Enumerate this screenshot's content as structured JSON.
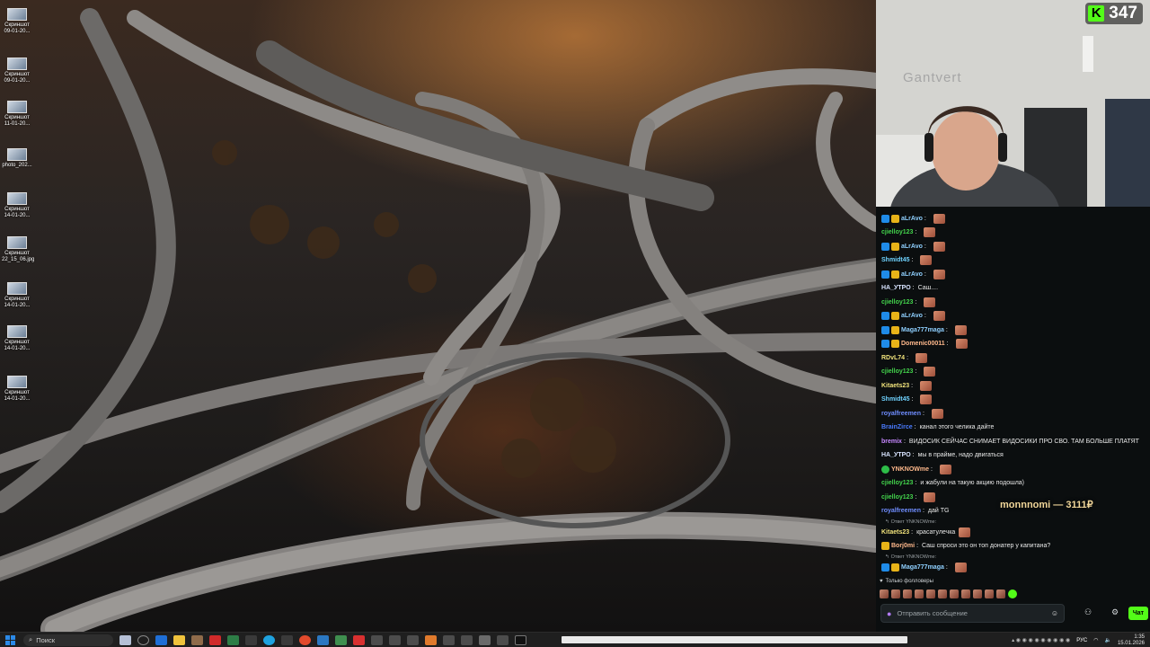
{
  "desktop": {
    "icons": [
      {
        "line1": "Скриншот",
        "line2": "09-01-20..."
      },
      {
        "line1": "Скриншот",
        "line2": "09-01-20..."
      },
      {
        "line1": "Скриншот",
        "line2": "11-01-20..."
      },
      {
        "line1": "photo_202...",
        "line2": ""
      },
      {
        "line1": "Скриншот",
        "line2": "14-01-20..."
      },
      {
        "line1": "Скриншот",
        "line2": "22_15_06.jpg"
      },
      {
        "line1": "Скриншот",
        "line2": "14-01-20..."
      },
      {
        "line1": "Скриншот",
        "line2": "14-01-20..."
      },
      {
        "line1": "Скриншот",
        "line2": "14-01-20..."
      }
    ]
  },
  "stream": {
    "platform_icon": "kick-logo-icon",
    "viewers": "347",
    "wall_logo": "Gantvert",
    "accent": "#53fc18"
  },
  "chat": {
    "messages": [
      {
        "badges": [
          "blue",
          "gold"
        ],
        "user": "aLrAvo",
        "color": "#8fd0ff",
        "text": "",
        "emotes": 1
      },
      {
        "badges": [],
        "user": "cjielloy123",
        "color": "#43d44c",
        "text": "",
        "emotes": 1
      },
      {
        "badges": [
          "blue",
          "gold"
        ],
        "user": "aLrAvo",
        "color": "#8fd0ff",
        "text": "",
        "emotes": 1
      },
      {
        "badges": [],
        "user": "Shmidt45",
        "color": "#6fd3ff",
        "text": "",
        "emotes": 1
      },
      {
        "badges": [
          "blue",
          "gold"
        ],
        "user": "aLrAvo",
        "color": "#8fd0ff",
        "text": "",
        "emotes": 1
      },
      {
        "badges": [],
        "user": "HA_УТРО",
        "color": "#d8e4ff",
        "text": "Саш....",
        "emotes": 0
      },
      {
        "badges": [],
        "user": "cjielloy123",
        "color": "#43d44c",
        "text": "",
        "emotes": 1
      },
      {
        "badges": [
          "blue",
          "gold"
        ],
        "user": "aLrAvo",
        "color": "#8fd0ff",
        "text": "",
        "emotes": 1
      },
      {
        "badges": [
          "blue",
          "gold"
        ],
        "user": "Maga777maga",
        "color": "#8fd0ff",
        "text": "",
        "emotes": 1
      },
      {
        "badges": [
          "blue",
          "gold"
        ],
        "user": "Domenic00011",
        "color": "#ffb98c",
        "text": "",
        "emotes": 1
      },
      {
        "badges": [],
        "user": "RDvL74",
        "color": "#f0e27b",
        "text": "",
        "emotes": 1
      },
      {
        "badges": [],
        "user": "cjielloy123",
        "color": "#43d44c",
        "text": "",
        "emotes": 1
      },
      {
        "badges": [],
        "user": "Kitaets23",
        "color": "#f0e27b",
        "text": "",
        "emotes": 1
      },
      {
        "badges": [],
        "user": "Shmidt45",
        "color": "#6fd3ff",
        "text": "",
        "emotes": 1
      },
      {
        "badges": [],
        "user": "royalfreemen",
        "color": "#6f8dff",
        "text": "",
        "emotes": 1
      },
      {
        "badges": [],
        "user": "BrainZirce",
        "color": "#4a7bff",
        "text": "канал этого челика дайте",
        "emotes": 0
      },
      {
        "badges": [],
        "user": "bremix",
        "color": "#c688ff",
        "text": "ВИДОСИК СЕЙЧАС СНИМАЕТ ВИДОСИКИ ПРО СВО. ТАМ БОЛЬШЕ ПЛАТЯТ",
        "emotes": 1
      },
      {
        "badges": [],
        "user": "HA_УТРО",
        "color": "#d8e4ff",
        "text": "мы в прайме, надо двигаться",
        "emotes": 0
      },
      {
        "badges": [
          "green"
        ],
        "user": "YNKNOWme",
        "color": "#ffb98c",
        "text": "",
        "emotes": 1
      },
      {
        "badges": [],
        "user": "cjielloy123",
        "color": "#43d44c",
        "text": "и жабули на такую акцию подошла)",
        "emotes": 0
      },
      {
        "badges": [],
        "user": "cjielloy123",
        "color": "#43d44c",
        "text": "",
        "emotes": 1
      },
      {
        "badges": [],
        "user": "royalfreemen",
        "color": "#6f8dff",
        "text": "дай ТG",
        "emotes": 0
      },
      {
        "reply": "Ответ YNKNOWme:",
        "badges": [],
        "user": "Kitaets23",
        "color": "#f0e27b",
        "text": "красатулечка",
        "emotes": 1
      },
      {
        "badges": [
          "gold"
        ],
        "user": "Borj0mi",
        "color": "#ffb98c",
        "text": "Саш спроси это он топ донатер у капитана?",
        "emotes": 0
      },
      {
        "reply": "Ответ YNKNOWme:",
        "badges": [
          "blue",
          "gold"
        ],
        "user": "Maga777maga",
        "color": "#8fd0ff",
        "text": "",
        "emotes": 1
      }
    ],
    "donation": "monnnomi — 3111₽",
    "followers_only": "Только фолловеры",
    "input_placeholder": "Отправить сообщение",
    "send_label": "Чат"
  },
  "taskbar": {
    "search_label": "Поиск",
    "language": "РУС",
    "time": "1:35",
    "date": "15.01.2026"
  }
}
